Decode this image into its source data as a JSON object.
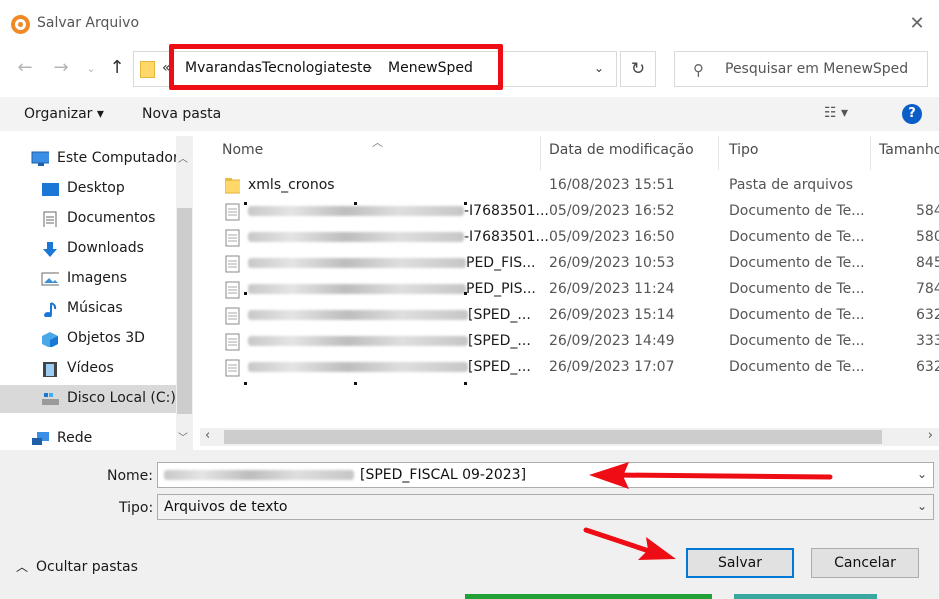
{
  "window": {
    "title": "Salvar Arquivo"
  },
  "address_bar": {
    "overflow_glyph": "«",
    "crumbs": [
      "MvarandasTecnologiateste",
      "MenewSped"
    ],
    "separator": "›"
  },
  "search": {
    "placeholder": "Pesquisar em MenewSped"
  },
  "toolbar": {
    "organize_label": "Organizar ▾",
    "new_folder_label": "Nova pasta"
  },
  "nav_pane": {
    "items": [
      {
        "label": "Este Computador",
        "icon": "computer-icon"
      },
      {
        "label": "Desktop",
        "icon": "desktop-icon"
      },
      {
        "label": "Documentos",
        "icon": "documents-icon"
      },
      {
        "label": "Downloads",
        "icon": "downloads-icon"
      },
      {
        "label": "Imagens",
        "icon": "pictures-icon"
      },
      {
        "label": "Músicas",
        "icon": "music-icon"
      },
      {
        "label": "Objetos 3D",
        "icon": "objects-3d-icon"
      },
      {
        "label": "Vídeos",
        "icon": "videos-icon"
      },
      {
        "label": "Disco Local (C:)",
        "icon": "drive-icon",
        "selected": true
      },
      {
        "label": "Rede",
        "icon": "network-icon"
      }
    ]
  },
  "file_list": {
    "columns": [
      "Nome",
      "Data de modificação",
      "Tipo",
      "Tamanho"
    ],
    "rows": [
      {
        "name": "xmls_cronos",
        "name_suffix": "",
        "date": "16/08/2023 15:51",
        "type": "Pasta de arquivos",
        "size": "",
        "kind": "folder"
      },
      {
        "name": "",
        "name_suffix": "-I7683501...",
        "date": "05/09/2023 16:52",
        "type": "Documento de Te...",
        "size": "584",
        "kind": "text"
      },
      {
        "name": "",
        "name_suffix": "-I7683501...",
        "date": "05/09/2023 16:50",
        "type": "Documento de Te...",
        "size": "580",
        "kind": "text"
      },
      {
        "name": "",
        "name_suffix": "PED_FIS...",
        "date": "26/09/2023 10:53",
        "type": "Documento de Te...",
        "size": "845",
        "kind": "text"
      },
      {
        "name": "",
        "name_suffix": "PED_PIS...",
        "date": "26/09/2023 11:24",
        "type": "Documento de Te...",
        "size": "784",
        "kind": "text"
      },
      {
        "name": "",
        "name_suffix": "[SPED_...",
        "date": "26/09/2023 15:14",
        "type": "Documento de Te...",
        "size": "632",
        "kind": "text"
      },
      {
        "name": "",
        "name_suffix": "[SPED_...",
        "date": "26/09/2023 14:49",
        "type": "Documento de Te...",
        "size": "333",
        "kind": "text"
      },
      {
        "name": "",
        "name_suffix": "[SPED_...",
        "date": "26/09/2023 17:07",
        "type": "Documento de Te...",
        "size": "632",
        "kind": "text"
      }
    ]
  },
  "form": {
    "name_label": "Nome:",
    "name_value": "[SPED_FISCAL 09-2023]",
    "type_label": "Tipo:",
    "type_value": "Arquivos de texto"
  },
  "footer": {
    "hide_folders_label": "Ocultar pastas",
    "save_label": "Salvar",
    "cancel_label": "Cancelar"
  },
  "annotations": {
    "highlight_color": "#ee0d14",
    "arrow_color": "#ee0d14"
  }
}
